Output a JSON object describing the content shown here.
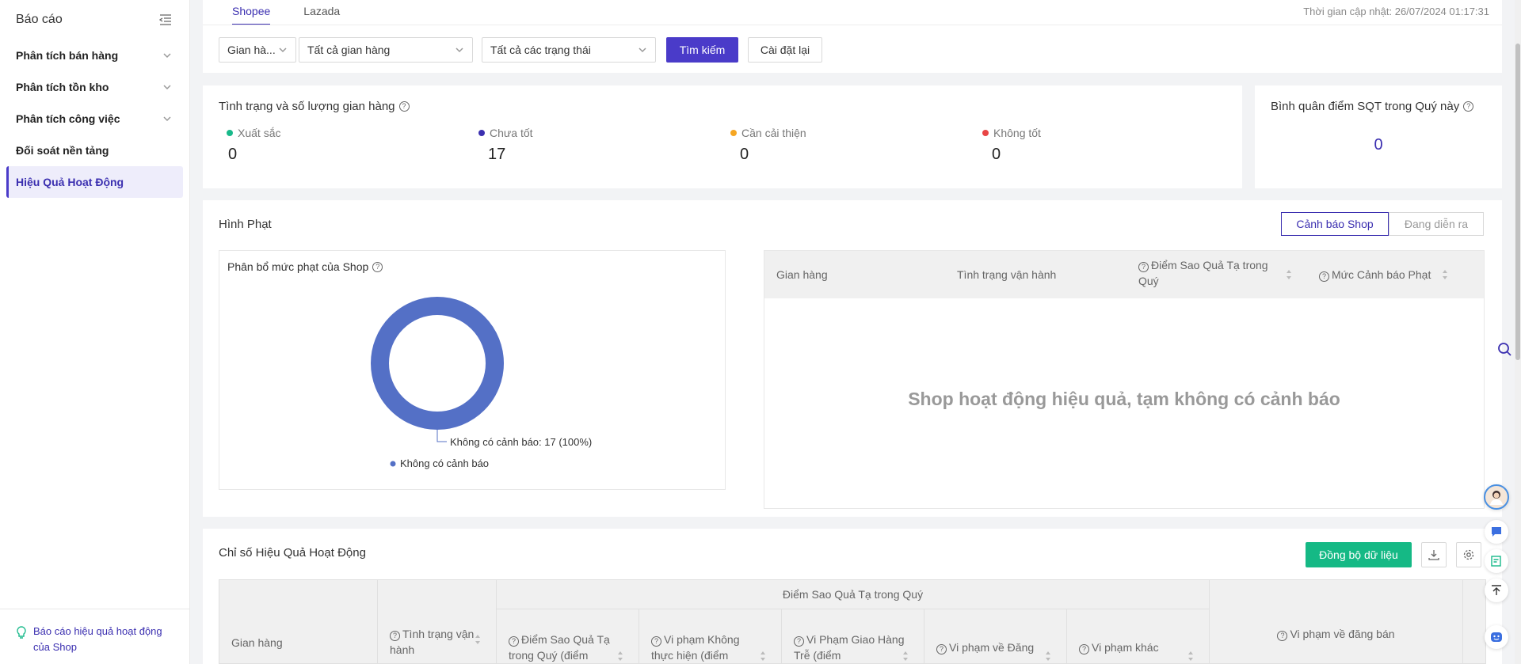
{
  "sidebar": {
    "title": "Báo cáo",
    "items": [
      {
        "label": "Phân tích bán hàng"
      },
      {
        "label": "Phân tích tồn kho"
      },
      {
        "label": "Phân tích công việc"
      },
      {
        "label": "Đối soát nền tảng"
      },
      {
        "label": "Hiệu Quả Hoạt Động"
      }
    ],
    "footer_link": "Báo cáo hiệu quả hoạt động của Shop"
  },
  "tabs": [
    {
      "label": "Shopee"
    },
    {
      "label": "Lazada"
    }
  ],
  "update_time": "Thời gian cập nhật: 26/07/2024 01:17:31",
  "filters": {
    "shop_type": "Gian hà...",
    "shop": "Tất cả gian hàng",
    "status": "Tất cả các trạng thái",
    "search_label": "Tìm kiếm",
    "reset_label": "Cài đặt lại"
  },
  "shop_status": {
    "title": "Tình trạng và số lượng gian hàng",
    "stats": [
      {
        "label": "Xuất sắc",
        "value": "0",
        "color": "#18b98a"
      },
      {
        "label": "Chưa tốt",
        "value": "17",
        "color": "#3b2fb0"
      },
      {
        "label": "Cần cải thiện",
        "value": "0",
        "color": "#f5a623"
      },
      {
        "label": "Không tốt",
        "value": "0",
        "color": "#e84545"
      }
    ]
  },
  "sqt": {
    "title": "Bình quân điểm SQT trong Quý này",
    "value": "0"
  },
  "penalty": {
    "title": "Hình Phạt",
    "toggle_on": "Cảnh báo Shop",
    "toggle_off": "Đang diễn ra",
    "chart_title": "Phân bổ mức phạt của Shop",
    "table_headers": [
      "Gian hàng",
      "Tình trạng vận hành",
      "Điểm Sao Quả Tạ trong Quý",
      "Mức Cảnh báo Phạt"
    ],
    "empty_message": "Shop hoạt động hiệu quả, tạm không có cảnh báo"
  },
  "chart_data": {
    "type": "pie",
    "categories": [
      "Không có cảnh báo"
    ],
    "values": [
      17
    ],
    "data_labels": [
      "Không có cảnh báo: 17 (100%)"
    ],
    "legend": [
      "Không có cảnh báo"
    ],
    "colors": [
      "#5470c6"
    ]
  },
  "performance": {
    "title": "Chỉ số Hiệu Quả Hoạt Động",
    "sync_label": "Đồng bộ dữ liệu",
    "headers": {
      "shop": "Gian hàng",
      "status": "Tình trạng vận hành",
      "group": "Điểm Sao Quả Tạ trong Quý",
      "cols": [
        "Điểm Sao Quả Tạ trong Quý (điểm",
        "Vi phạm Không thực hiện (điểm",
        "Vi Phạm Giao Hàng Trễ (điểm",
        "Vi phạm về Đăng",
        "Vi phạm khác"
      ],
      "listing": "Vi phạm về đăng bán"
    }
  }
}
